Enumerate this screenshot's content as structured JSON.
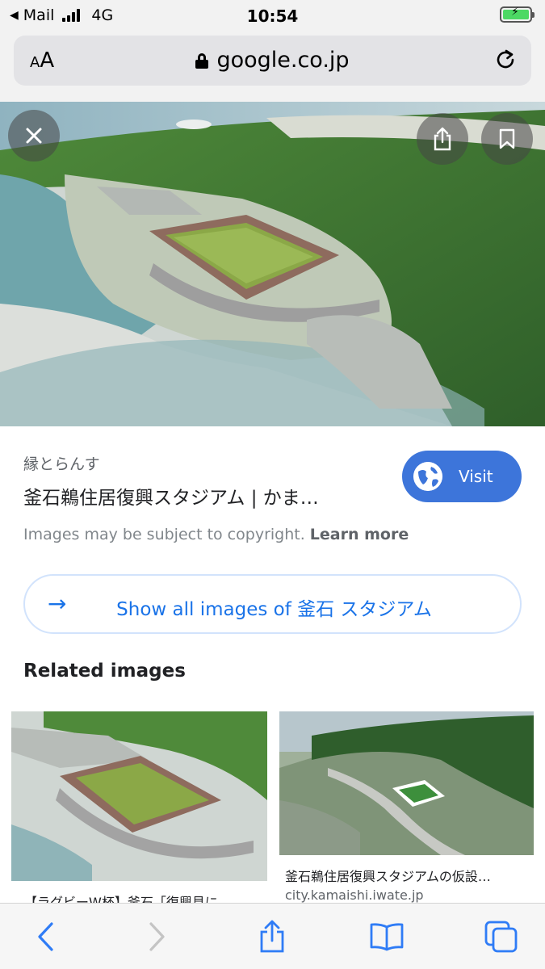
{
  "status_bar": {
    "back_app": "Mail",
    "network": "4G",
    "time": "10:54",
    "battery_icon": "battery-charging-icon"
  },
  "browser": {
    "text_size_label": "AA",
    "url": "google.co.jp",
    "lock_icon": "lock-icon",
    "reload_icon": "reload-icon"
  },
  "result": {
    "source": "縁とらんす",
    "title": "釜石鵜住居復興スタジアム | かま…",
    "visit_label": "Visit",
    "copyright_text": "Images may be subject to copyright.",
    "learn_more": "Learn more"
  },
  "show_all": {
    "label": "Show all images of 釜石 スタジアム"
  },
  "related": {
    "heading": "Related images",
    "items": [
      {
        "caption": "【ラグビーW杯】釜石「復興見に…",
        "domain": ""
      },
      {
        "caption": "釜石鵜住居復興スタジアムの仮設…",
        "domain": "city.kamaishi.iwate.jp"
      }
    ]
  },
  "toolbar": {
    "back_icon": "chevron-left-icon",
    "forward_icon": "chevron-right-icon",
    "share_icon": "share-icon",
    "bookmarks_icon": "book-icon",
    "tabs_icon": "tabs-icon"
  },
  "colors": {
    "accent": "#1a73e8",
    "visit_button": "#3d75da",
    "battery": "#4cd964"
  }
}
